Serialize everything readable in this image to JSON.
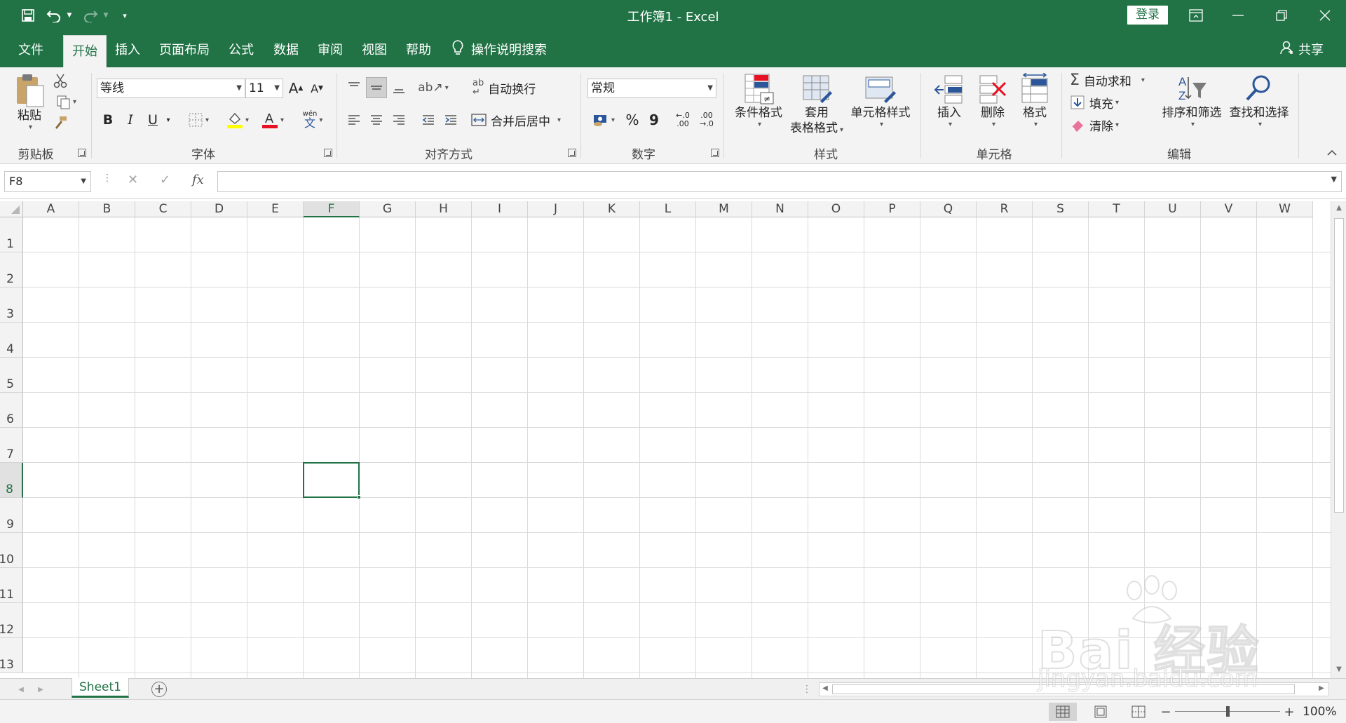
{
  "window": {
    "title": "工作簿1  -  Excel",
    "login_label": "登录"
  },
  "tabs": [
    "文件",
    "开始",
    "插入",
    "页面布局",
    "公式",
    "数据",
    "审阅",
    "视图",
    "帮助"
  ],
  "active_tab": "开始",
  "tell_me": "操作说明搜索",
  "share_label": "共享",
  "ribbon": {
    "clipboard": {
      "paste": "粘贴",
      "label": "剪贴板"
    },
    "font": {
      "name": "等线",
      "size": "11",
      "bold": "B",
      "italic": "I",
      "underline": "U",
      "label": "字体",
      "phonetic_top": "wén",
      "phonetic_bottom": "文"
    },
    "alignment": {
      "wrap_text": "自动换行",
      "merge_center": "合并后居中",
      "label": "对齐方式"
    },
    "number": {
      "format": "常规",
      "percent": "%",
      "comma": "9",
      "inc_top": "←.0",
      "inc_bottom": ".00",
      "dec_top": ".00",
      "dec_bottom": "→.0",
      "label": "数字"
    },
    "styles": {
      "conditional": "条件格式",
      "table_format_line1": "套用",
      "table_format_line2": "表格格式",
      "cell_styles": "单元格样式",
      "label": "样式"
    },
    "cells": {
      "insert": "插入",
      "delete": "删除",
      "format": "格式",
      "label": "单元格"
    },
    "editing": {
      "autosum": "自动求和",
      "fill": "填充",
      "clear": "清除",
      "sort_filter": "排序和筛选",
      "find_select": "查找和选择",
      "label": "编辑"
    }
  },
  "formula_bar": {
    "name_box": "F8",
    "cancel_glyph": "✕",
    "enter_glyph": "✓",
    "fx_label": "fx",
    "formula": ""
  },
  "grid": {
    "columns": [
      "A",
      "B",
      "C",
      "D",
      "E",
      "F",
      "G",
      "H",
      "I",
      "J",
      "K",
      "L",
      "M",
      "N",
      "O",
      "P",
      "Q",
      "R",
      "S",
      "T",
      "U",
      "V",
      "W"
    ],
    "rows": [
      "1",
      "2",
      "3",
      "4",
      "5",
      "6",
      "7",
      "8",
      "9",
      "10",
      "11",
      "12",
      "13"
    ],
    "selected_cell": "F8",
    "selected_column": "F",
    "selected_row": "8"
  },
  "sheets": [
    "Sheet1"
  ],
  "active_sheet": "Sheet1",
  "status": {
    "zoom": "100%",
    "zoom_minus": "−",
    "zoom_plus": "+"
  },
  "watermark": {
    "main": "Bai 经验",
    "sub": "jingyan.baidu.com"
  },
  "colors": {
    "brand_green": "#217346",
    "ribbon_bg": "#f3f3f3",
    "font_color_red": "#e81123",
    "highlight_yellow": "#ffff00"
  }
}
